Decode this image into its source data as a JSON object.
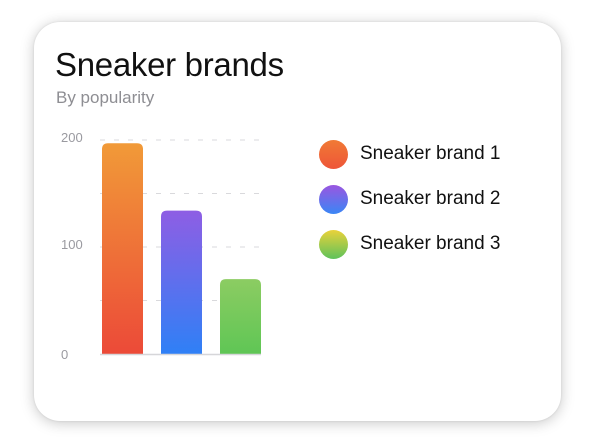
{
  "card": {
    "title": "Sneaker brands",
    "subtitle": "By popularity"
  },
  "chart_data": {
    "type": "bar",
    "title": "Sneaker brands",
    "subtitle": "By popularity",
    "categories": [
      "Sneaker brand 1",
      "Sneaker brand 2",
      "Sneaker brand 3"
    ],
    "values": [
      197,
      134,
      70
    ],
    "ylim": [
      0,
      200
    ],
    "yticks": [
      0,
      100,
      200
    ],
    "ytick_labels": [
      "0",
      "100",
      "200"
    ],
    "grid": true,
    "grid_style": "dashed",
    "legend_position": "right",
    "series_colors": [
      {
        "top": "#f19a38",
        "bottom": "#ec4a38"
      },
      {
        "top": "#8e5ee4",
        "bottom": "#2f80f6"
      },
      {
        "top": "#8ccc62",
        "bottom": "#5fc655"
      }
    ],
    "legend_colors": [
      {
        "top": "#f07a35",
        "bottom": "#ee5538"
      },
      {
        "top": "#9a56e0",
        "bottom": "#3a86f5"
      },
      {
        "top": "#ead23a",
        "bottom": "#5ec25b"
      }
    ]
  },
  "legend": [
    {
      "label": "Sneaker brand 1"
    },
    {
      "label": "Sneaker brand 2"
    },
    {
      "label": "Sneaker brand 3"
    }
  ],
  "colors": {
    "axis_line": "#d6d6d9",
    "grid_line": "#d9d9dc",
    "tick_text": "#9a9aa0"
  }
}
